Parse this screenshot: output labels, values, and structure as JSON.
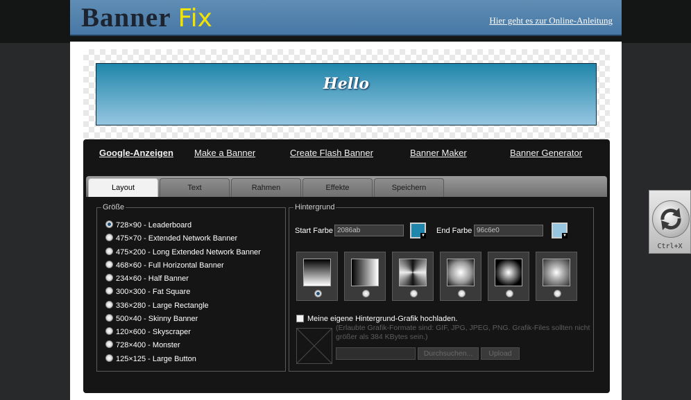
{
  "header": {
    "logo_banner": "Banner",
    "logo_fix": "Fix",
    "help_link": "Hier geht es zur Online-Anleitung"
  },
  "preview": {
    "text": "Hello",
    "start_color": "#2086ab",
    "end_color": "#96c6e0"
  },
  "nav_links": [
    "Google-Anzeigen",
    "Make a Banner",
    "Create Flash Banner",
    "Banner Maker",
    "Banner Generator"
  ],
  "tabs": [
    "Layout",
    "Text",
    "Rahmen",
    "Effekte",
    "Speichern"
  ],
  "active_tab": "Layout",
  "size": {
    "legend": "Größe",
    "options": [
      "728×90 - Leaderboard",
      "475×70 - Extended Network Banner",
      "475×200 - Long Extended Network Banner",
      "468×60 - Full Horizontal Banner",
      "234×60 - Half Banner",
      "300×300 - Fat Square",
      "336×280 - Large Rectangle",
      "500×40 - Skinny Banner",
      "120×600 - Skyscraper",
      "728×400 - Monster",
      "125×125 - Large Button"
    ],
    "selected": "728×90 - Leaderboard"
  },
  "background": {
    "legend": "Hintergrund",
    "start_label": "Start Farbe",
    "start_value": "2086ab",
    "end_label": "End Farbe",
    "end_value": "96c6e0",
    "gradient_styles": [
      "linear-vertical",
      "linear-horizontal",
      "square-center",
      "radial-soft",
      "radial-spot",
      "star-burst"
    ],
    "selected_gradient": "linear-vertical",
    "upload_checkbox_label": "Meine eigene Hintergrund-Grafik hochladen.",
    "upload_note": "(Erlaubte Grafik-Formate sind: GIF, JPG, JPEG, PNG. Grafik-Files sollten nicht größer als 384 KBytes sein.)",
    "browse_label": "Durchsuchen...",
    "upload_label": "Upload"
  },
  "widget": {
    "shortcut": "Ctrl+X",
    "icon": "refresh-icon"
  }
}
